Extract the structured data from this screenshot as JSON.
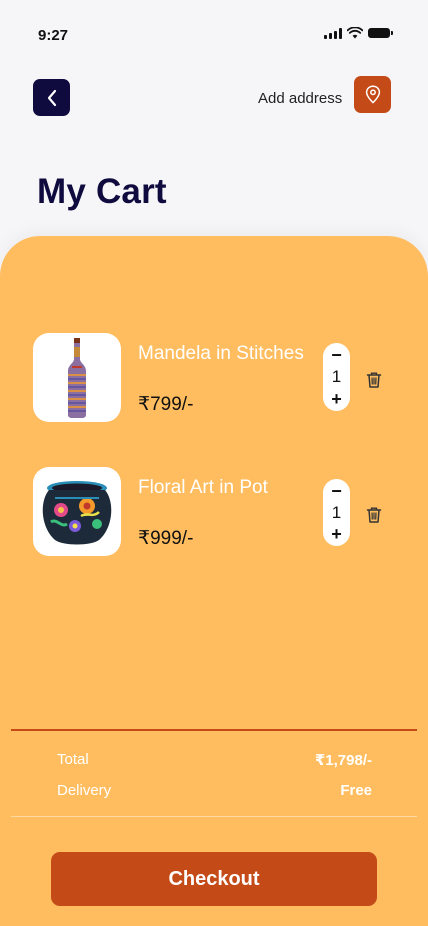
{
  "status_bar": {
    "time": "9:27"
  },
  "header": {
    "add_address_label": "Add address",
    "title": "My Cart"
  },
  "cart": {
    "items": [
      {
        "name": "Mandela in Stitches",
        "price": "₹799/-",
        "quantity": "1",
        "image": "embroidered-bottle"
      },
      {
        "name": "Floral Art in Pot",
        "price": "₹999/-",
        "quantity": "1",
        "image": "painted-floral-pot"
      }
    ],
    "stepper": {
      "minus": "−",
      "plus": "+"
    }
  },
  "summary": {
    "total_label": "Total",
    "total_value": "₹1,798/-",
    "delivery_label": "Delivery",
    "delivery_value": "Free"
  },
  "checkout_label": "Checkout",
  "colors": {
    "navy": "#0f0b3e",
    "accent": "#c44a18",
    "panel": "#ffbd5f",
    "background": "#f6f6f8"
  }
}
